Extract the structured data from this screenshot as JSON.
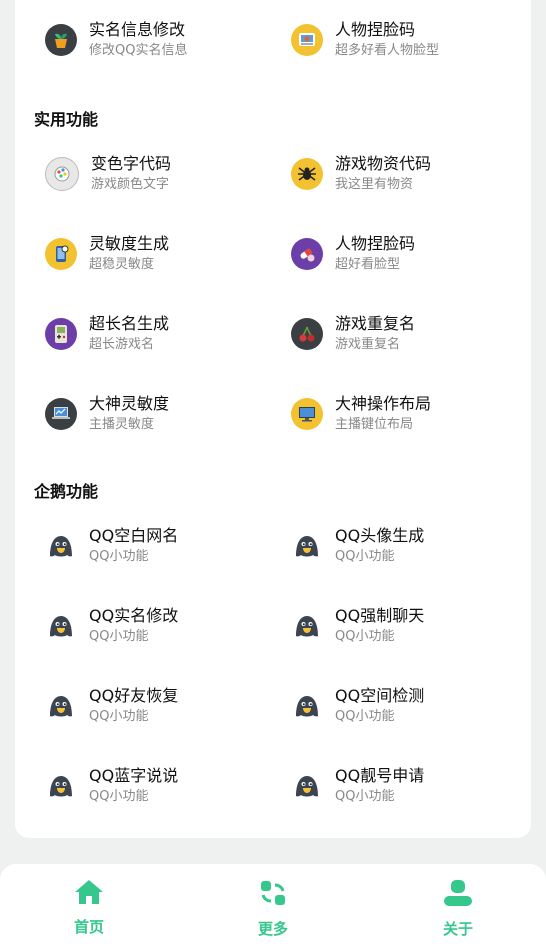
{
  "top_items": [
    {
      "title": "实名信息修改",
      "sub": "修改QQ实名信息",
      "icon": "plant-pot-icon"
    },
    {
      "title": "人物捏脸码",
      "sub": "超多好看人物脸型",
      "icon": "photo-frame-icon"
    }
  ],
  "practical": {
    "heading": "实用功能",
    "items": [
      {
        "title": "变色字代码",
        "sub": "游戏颜色文字",
        "icon": "color-palette-icon"
      },
      {
        "title": "游戏物资代码",
        "sub": "我这里有物资",
        "icon": "spider-icon"
      },
      {
        "title": "灵敏度生成",
        "sub": "超稳灵敏度",
        "icon": "phone-settings-icon"
      },
      {
        "title": "人物捏脸码",
        "sub": "超好看脸型",
        "icon": "pills-icon"
      },
      {
        "title": "超长名生成",
        "sub": "超长游戏名",
        "icon": "gameboy-icon"
      },
      {
        "title": "游戏重复名",
        "sub": "游戏重复名",
        "icon": "cherries-icon"
      },
      {
        "title": "大神灵敏度",
        "sub": "主播灵敏度",
        "icon": "laptop-chart-icon"
      },
      {
        "title": "大神操作布局",
        "sub": "主播键位布局",
        "icon": "desktop-computer-icon"
      }
    ]
  },
  "qq": {
    "heading": "企鹅功能",
    "items": [
      {
        "title": "QQ空白网名",
        "sub": "QQ小功能",
        "icon": "qq-penguin-icon"
      },
      {
        "title": "QQ头像生成",
        "sub": "QQ小功能",
        "icon": "qq-penguin-icon"
      },
      {
        "title": "QQ实名修改",
        "sub": "QQ小功能",
        "icon": "qq-penguin-icon"
      },
      {
        "title": "QQ强制聊天",
        "sub": "QQ小功能",
        "icon": "qq-penguin-icon"
      },
      {
        "title": "QQ好友恢复",
        "sub": "QQ小功能",
        "icon": "qq-penguin-icon"
      },
      {
        "title": "QQ空间检测",
        "sub": "QQ小功能",
        "icon": "qq-penguin-icon"
      },
      {
        "title": "QQ蓝字说说",
        "sub": "QQ小功能",
        "icon": "qq-penguin-icon"
      },
      {
        "title": "QQ靓号申请",
        "sub": "QQ小功能",
        "icon": "qq-penguin-icon"
      }
    ]
  },
  "nav": {
    "accent": "#36c78d",
    "items": [
      {
        "label": "首页",
        "icon": "home-icon"
      },
      {
        "label": "更多",
        "icon": "refresh-grid-icon"
      },
      {
        "label": "关于",
        "icon": "user-icon"
      }
    ]
  }
}
